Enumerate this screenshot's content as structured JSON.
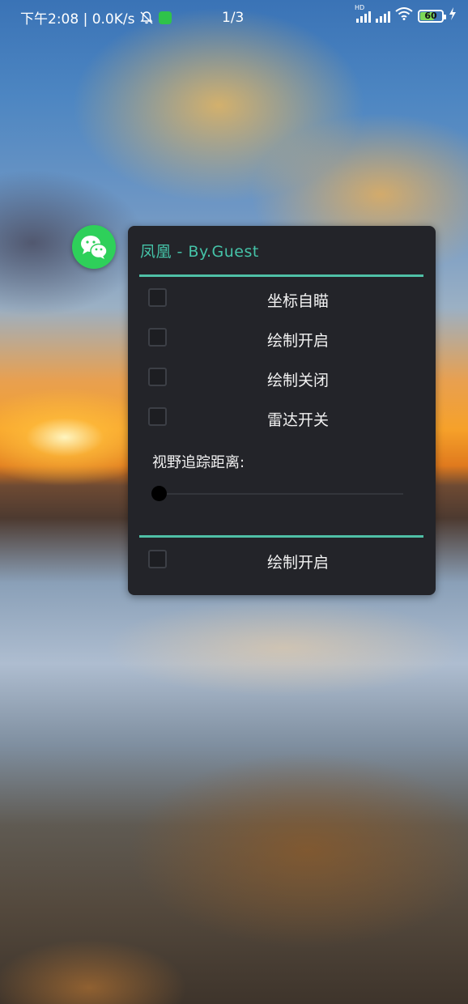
{
  "status_bar": {
    "time_network": "下午2:08 | 0.0K/s",
    "page_indicator": "1/3",
    "network_type": "HD",
    "battery_level": "60"
  },
  "floating_app": {
    "icon": "wechat-icon",
    "color": "#2ed05a"
  },
  "menu": {
    "title": "凤凰 - By.Guest",
    "accent_color": "#4fc0a6",
    "options": [
      {
        "label": "坐标自瞄",
        "checked": false
      },
      {
        "label": "绘制开启",
        "checked": false
      },
      {
        "label": "绘制关闭",
        "checked": false
      },
      {
        "label": "雷达开关",
        "checked": false
      }
    ],
    "slider": {
      "label": "视野追踪距离:",
      "value": 0
    },
    "footer_option": {
      "label": "绘制开启",
      "checked": false
    }
  }
}
